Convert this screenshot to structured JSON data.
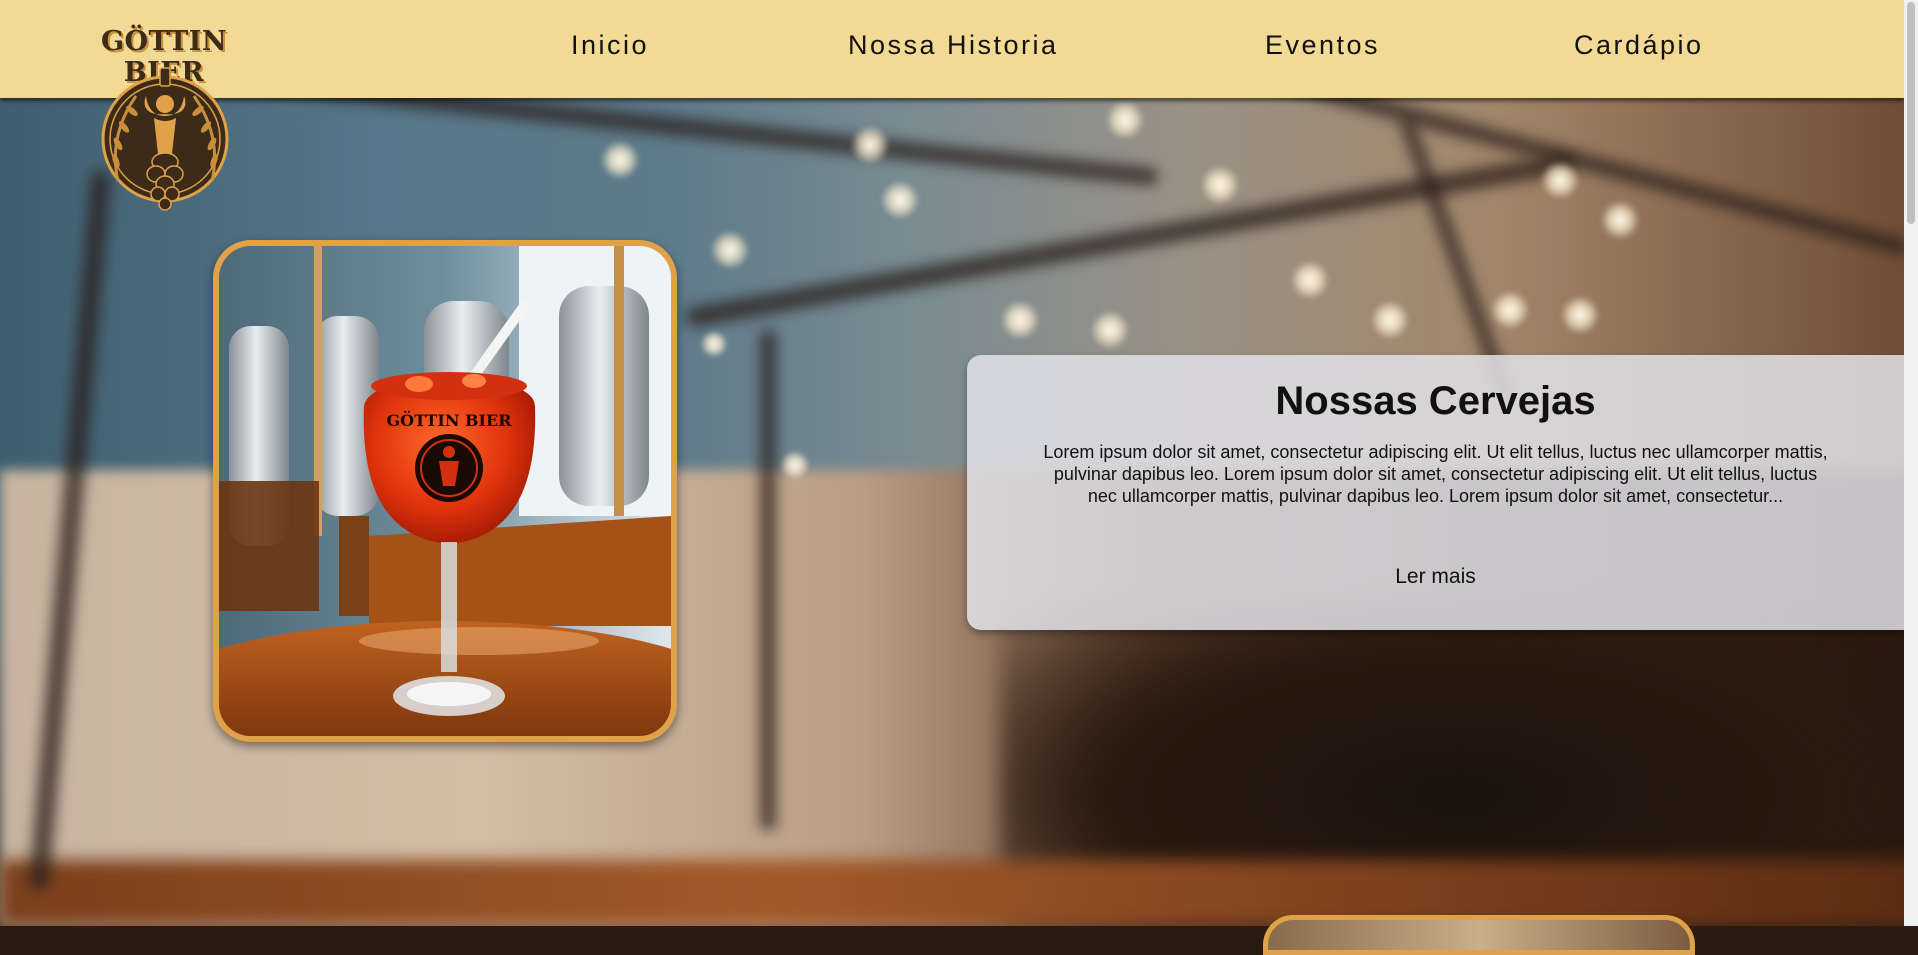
{
  "brand": {
    "name": "GÖTTIN BIER",
    "colors": {
      "header_bg": "#f3da94",
      "accent": "#e0a248",
      "logo_dark": "#3d2b1a"
    }
  },
  "nav": {
    "items": [
      {
        "label": "Inicio"
      },
      {
        "label": "Nossa Historia"
      },
      {
        "label": "Eventos"
      },
      {
        "label": "Cardápio"
      }
    ]
  },
  "hero": {
    "photo": {
      "glass_logo": "GÖTTIN BIER",
      "description_icon": "beer-glass-photo"
    },
    "panel": {
      "title": "Nossas Cervejas",
      "body": "Lorem ipsum dolor sit amet, consectetur adipiscing elit. Ut elit tellus, luctus nec ullamcorper mattis, pulvinar dapibus leo. Lorem ipsum dolor sit amet, consectetur adipiscing elit. Ut elit tellus, luctus nec ullamcorper mattis, pulvinar dapibus leo. Lorem ipsum dolor sit amet, consectetur...",
      "link_label": "Ler mais"
    }
  }
}
